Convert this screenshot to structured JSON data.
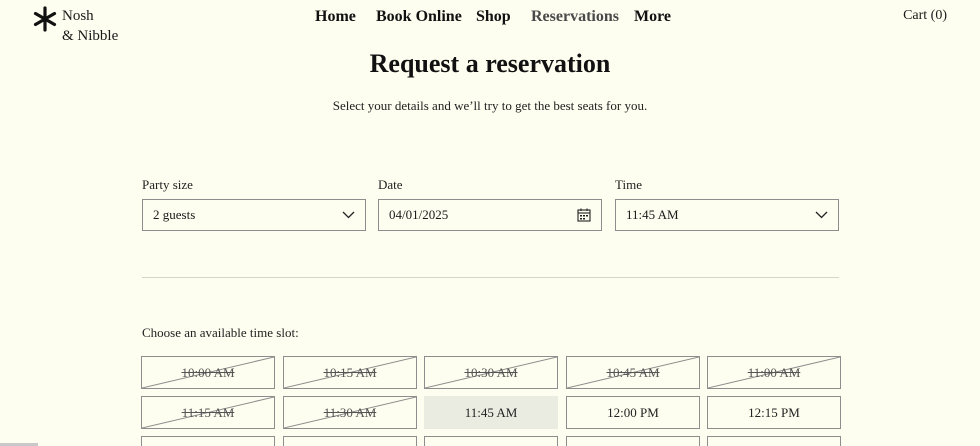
{
  "brand": {
    "line1": "Nosh",
    "line2": "& Nibble"
  },
  "nav": {
    "items": [
      {
        "label": "Home"
      },
      {
        "label": "Book Online"
      },
      {
        "label": "Shop"
      },
      {
        "label": "Reservations"
      },
      {
        "label": "More"
      }
    ],
    "active": "Reservations",
    "cart_label": "Cart (0)"
  },
  "page": {
    "title": "Request a reservation",
    "subtitle": "Select your details and we’ll try to get the best seats for you."
  },
  "form": {
    "party_size": {
      "label": "Party size",
      "value": "2 guests"
    },
    "date": {
      "label": "Date",
      "value": "04/01/2025"
    },
    "time": {
      "label": "Time",
      "value": "11:45 AM"
    }
  },
  "slots": {
    "label": "Choose an available time slot:",
    "items": [
      {
        "time": "10:00 AM",
        "state": "unavailable"
      },
      {
        "time": "10:15 AM",
        "state": "unavailable"
      },
      {
        "time": "10:30 AM",
        "state": "unavailable"
      },
      {
        "time": "10:45 AM",
        "state": "unavailable"
      },
      {
        "time": "11:00 AM",
        "state": "unavailable"
      },
      {
        "time": "11:15 AM",
        "state": "unavailable"
      },
      {
        "time": "11:30 AM",
        "state": "unavailable"
      },
      {
        "time": "11:45 AM",
        "state": "selected"
      },
      {
        "time": "12:00 PM",
        "state": "available"
      },
      {
        "time": "12:15 PM",
        "state": "available"
      }
    ]
  },
  "colors": {
    "background": "#fdfeef",
    "selected_slot": "#ebece1",
    "border": "#8d8d8d"
  }
}
